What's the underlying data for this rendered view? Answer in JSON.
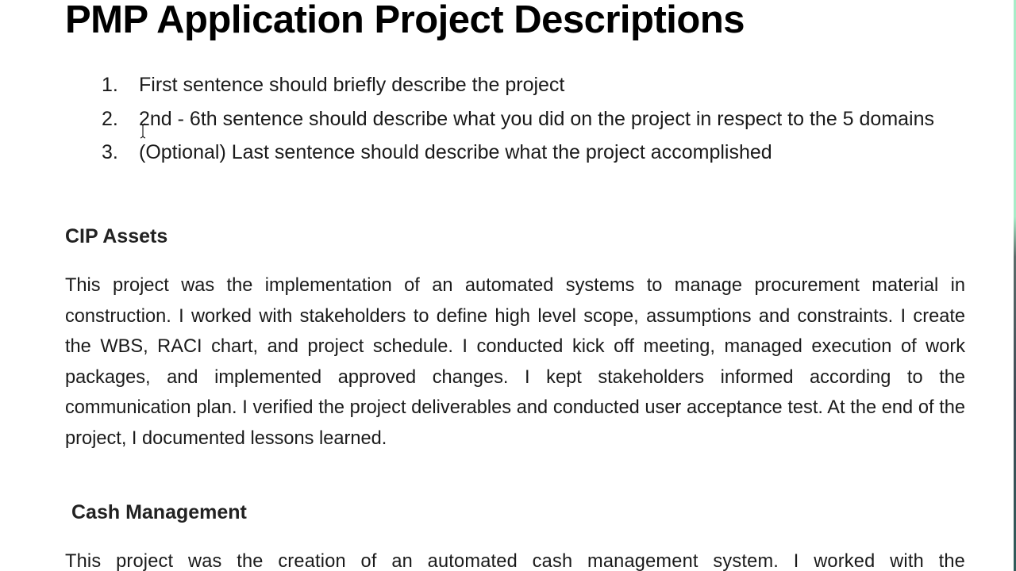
{
  "document": {
    "title": "PMP Application Project Descriptions",
    "guidelines": [
      {
        "number": "1.",
        "text": "First sentence should briefly describe the project"
      },
      {
        "number": "2.",
        "text": "2nd - 6th sentence should describe what you did on the project in respect to the 5 domains"
      },
      {
        "number": "3.",
        "text": "(Optional) Last sentence should describe what the project accomplished"
      }
    ],
    "sections": [
      {
        "heading": "CIP Assets",
        "body": "This project was the implementation of an automated systems to manage procurement material in construction. I worked with stakeholders to define high level scope, assumptions and constraints. I create the WBS, RACI chart, and project schedule. I conducted kick off meeting, managed execution of work packages, and implemented approved changes. I kept stakeholders informed according to the communication plan. I verified the project deliverables and conducted user acceptance test. At the end of the project, I documented lessons learned."
      },
      {
        "heading": "Cash Management",
        "body": "This project was the creation of an automated cash management system. I worked with the"
      }
    ]
  },
  "cursor": {
    "type": "text-ibeam-icon"
  }
}
